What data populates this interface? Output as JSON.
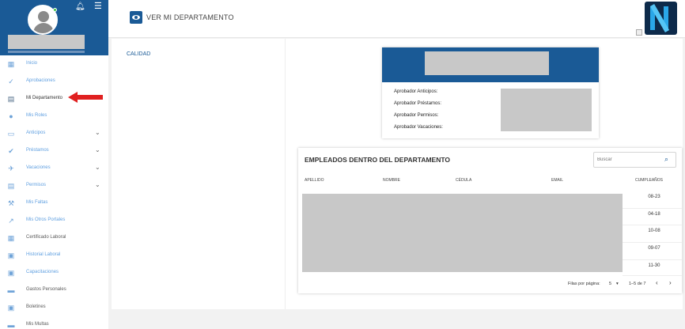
{
  "sidebar": {
    "items": [
      {
        "label": "Inicio",
        "icon": "dashboard-icon",
        "glyph": "▦",
        "chevron": false,
        "style": "blue"
      },
      {
        "label": "Aprobaciones",
        "icon": "check-icon",
        "glyph": "✓",
        "chevron": false,
        "style": "blue"
      },
      {
        "label": "Mi Departamento",
        "icon": "clipboard-icon",
        "glyph": "▤",
        "chevron": false,
        "style": "active"
      },
      {
        "label": "Mis Roles",
        "icon": "person-icon",
        "glyph": "●",
        "chevron": false,
        "style": "blue"
      },
      {
        "label": "Anticipos",
        "icon": "money-icon",
        "glyph": "▭",
        "chevron": true,
        "style": "blue"
      },
      {
        "label": "Préstamos",
        "icon": "handshake-icon",
        "glyph": "✔",
        "chevron": true,
        "style": "blue"
      },
      {
        "label": "Vacaciones",
        "icon": "airplane-icon",
        "glyph": "✈",
        "chevron": true,
        "style": "blue"
      },
      {
        "label": "Permisos",
        "icon": "document-icon",
        "glyph": "▤",
        "chevron": true,
        "style": "blue"
      },
      {
        "label": "Mis Faltas",
        "icon": "gavel-icon",
        "glyph": "⚒",
        "chevron": false,
        "style": "blue"
      },
      {
        "label": "Mis Otros Portales",
        "icon": "external-link-icon",
        "glyph": "↗",
        "chevron": false,
        "style": "blue"
      },
      {
        "label": "Certificado Laboral",
        "icon": "calendar-icon",
        "glyph": "▦",
        "chevron": false,
        "style": "dark"
      },
      {
        "label": "Historial Laboral",
        "icon": "history-icon",
        "glyph": "▣",
        "chevron": false,
        "style": "blue"
      },
      {
        "label": "Capacitaciones",
        "icon": "badge-icon",
        "glyph": "▣",
        "chevron": false,
        "style": "blue"
      },
      {
        "label": "Gastos Personales",
        "icon": "briefcase-icon",
        "glyph": "▬",
        "chevron": false,
        "style": "dark"
      },
      {
        "label": "Boletines",
        "icon": "newsletter-icon",
        "glyph": "▣",
        "chevron": false,
        "style": "dark"
      },
      {
        "label": "Mis Multas",
        "icon": "wallet-icon",
        "glyph": "▬",
        "chevron": false,
        "style": "dark"
      }
    ]
  },
  "header": {
    "title": "VER MI DEPARTAMENTO"
  },
  "left_panel": {
    "heading": "CALIDAD"
  },
  "info_card": {
    "labels": [
      "Aprobador Anticipos:",
      "Aprobador Préstamos:",
      "Aprobador Permisos:",
      "Aprobador Vacaciones:"
    ]
  },
  "employees": {
    "title": "EMPLEADOS DENTRO DEL DEPARTAMENTO",
    "search_placeholder": "Buscar",
    "columns": [
      "APELLIDO",
      "NOMBRE",
      "CÉDULA",
      "EMAIL",
      "CUMPLEAÑOS"
    ],
    "birthdays": [
      "08-23",
      "04-18",
      "10-08",
      "09-07",
      "11-30"
    ],
    "pager": {
      "rows_label": "Filas por página:",
      "rows_value": "5",
      "range": "1–5 de 7",
      "prev": "‹",
      "next": "›"
    }
  },
  "colors": {
    "brand": "#1a5a96",
    "accent": "#5f9fe0",
    "arrow": "#e02020"
  }
}
